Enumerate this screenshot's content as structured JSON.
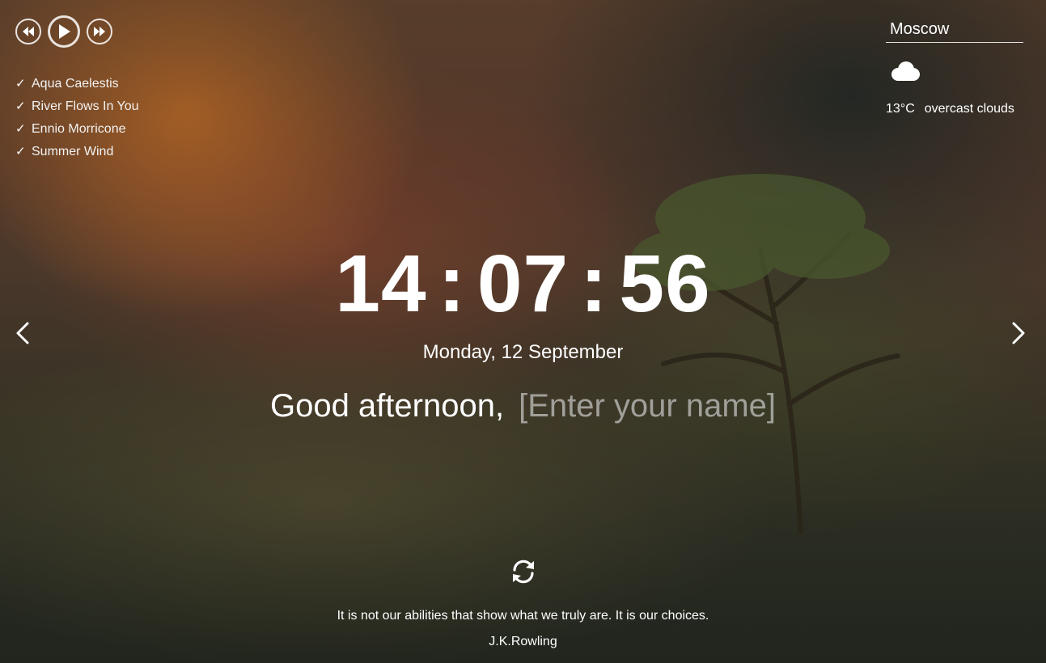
{
  "player": {
    "prev_icon": "rewind-icon",
    "play_icon": "play-icon",
    "next_icon": "fast-forward-icon"
  },
  "playlist": [
    {
      "title": "Aqua Caelestis",
      "check": "✓"
    },
    {
      "title": "River Flows In You",
      "check": "✓"
    },
    {
      "title": "Ennio Morricone",
      "check": "✓"
    },
    {
      "title": "Summer Wind",
      "check": "✓"
    }
  ],
  "weather": {
    "city": "Moscow",
    "icon": "cloud-icon",
    "temperature": "13°C",
    "description": "overcast clouds"
  },
  "clock": {
    "hours": "14",
    "minutes": "07",
    "seconds": "56",
    "separator": ":"
  },
  "date": "Monday, 12 September",
  "greeting": {
    "text": "Good afternoon,",
    "name_placeholder": "[Enter your name]"
  },
  "quote": {
    "text": "It is not our abilities that show what we truly are. It is our choices.",
    "author": "J.K.Rowling"
  },
  "colors": {
    "text": "#ffffff",
    "placeholder": "#d7d7d7"
  }
}
